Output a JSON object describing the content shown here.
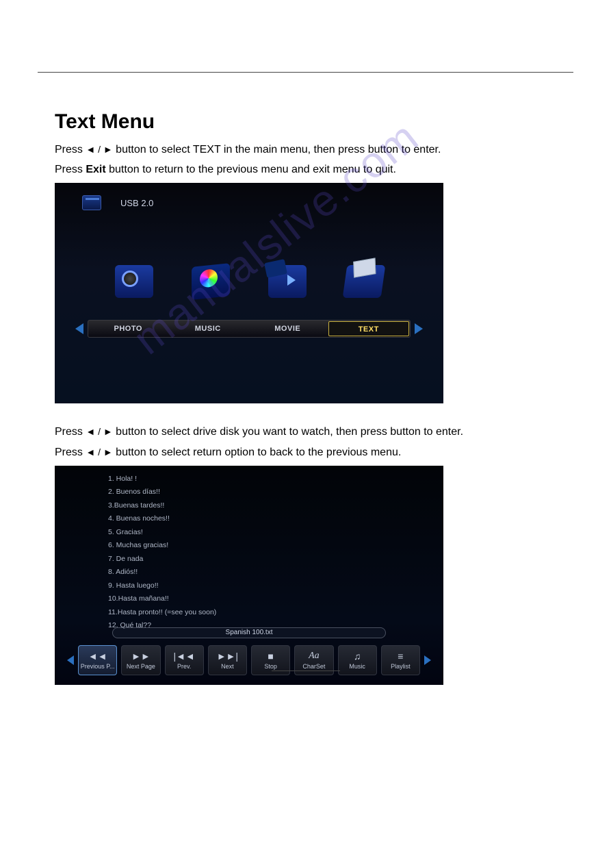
{
  "doc": {
    "title": "Text Menu",
    "instr1_pre": "Press ",
    "instr1_mid": " button to select TEXT in the main menu,  then press ",
    "instr1_post": " button to enter.",
    "instr2_pre": "Press ",
    "instr2_bold": "Exit",
    "instr2_post": " button to return to the previous menu and exit menu to quit.",
    "arrow_lr": "◄ / ►",
    "instr3_pre": "Press ",
    "instr3_mid": " button to select drive disk you want to watch, then press ",
    "instr3_post": " button to enter.",
    "instr4_pre": "Press ",
    "instr4_post": " button to select return option to back to the previous menu."
  },
  "shot1": {
    "usb_label": "USB 2.0",
    "tabs": [
      {
        "label": "PHOTO",
        "selected": false
      },
      {
        "label": "MUSIC",
        "selected": false
      },
      {
        "label": "MOVIE",
        "selected": false
      },
      {
        "label": "TEXT",
        "selected": true
      }
    ]
  },
  "shot2": {
    "lines": [
      "1. Hola! !",
      "2. Buenos días!!",
      "3.Buenas tardes!!",
      "4. Buenas noches!!",
      "5. Gracias!",
      "6. Muchas gracias!",
      "7. De nada",
      "8. Adiós!!",
      "9. Hasta luego!!",
      "10.Hasta mañana!!",
      "11.Hasta pronto!! (=see you soon)",
      "12. Qué tal??"
    ],
    "filename": "Spanish 100.txt",
    "controls": [
      {
        "glyph": "◄◄",
        "label": "Previous P...",
        "name": "prev-page-button",
        "selected": true
      },
      {
        "glyph": "►►",
        "label": "Next Page",
        "name": "next-page-button",
        "selected": false
      },
      {
        "glyph": "|◄◄",
        "label": "Prev.",
        "name": "prev-button",
        "selected": false
      },
      {
        "glyph": "►►|",
        "label": "Next",
        "name": "next-button",
        "selected": false
      },
      {
        "glyph": "■",
        "label": "Stop",
        "name": "stop-button",
        "selected": false
      },
      {
        "glyph": "Aa",
        "label": "CharSet",
        "name": "charset-button",
        "selected": false,
        "italic": true
      },
      {
        "glyph": "♫",
        "label": "Music",
        "name": "music-button",
        "selected": false
      },
      {
        "glyph": "≡",
        "label": "Playlist",
        "name": "playlist-button",
        "selected": false
      }
    ]
  },
  "watermark": "manualslive.com"
}
